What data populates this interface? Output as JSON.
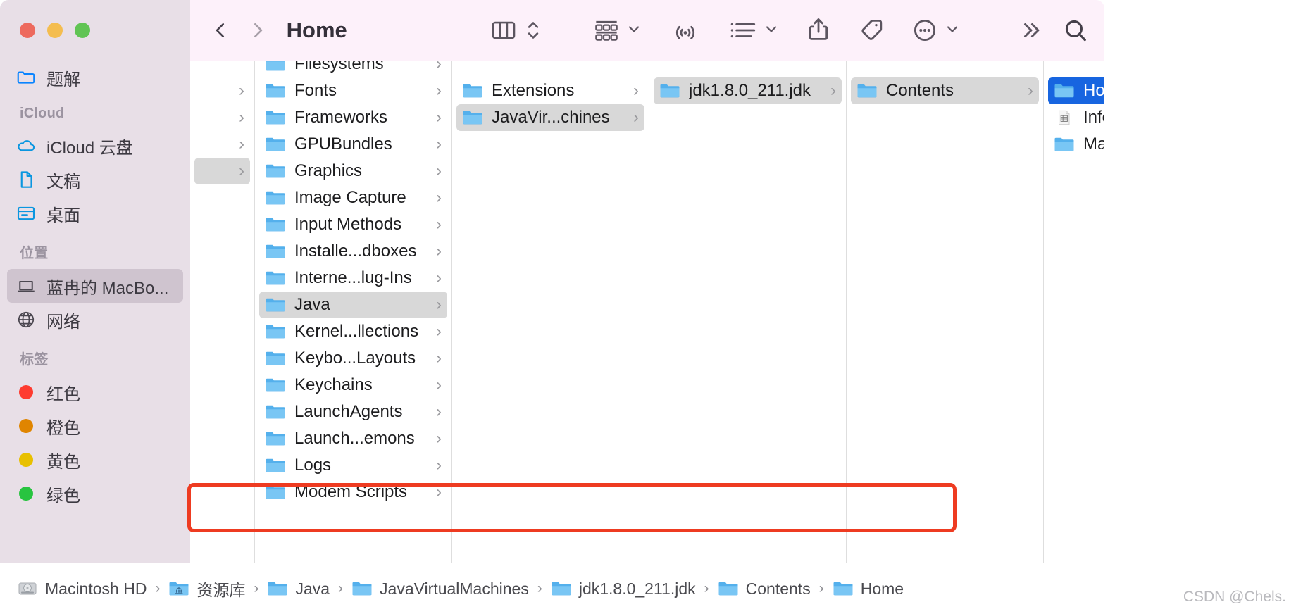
{
  "window": {
    "title": "Home",
    "traffic_lights": [
      {
        "name": "close",
        "color": "#ed6a5e"
      },
      {
        "name": "minimize",
        "color": "#f4bd4f"
      },
      {
        "name": "maximize",
        "color": "#61c454"
      }
    ]
  },
  "toolbar": {
    "back_label": "Back",
    "forward_label": "Forward",
    "title": "Home",
    "view_column_label": "Column View",
    "view_stepper_label": "View Options",
    "group_label": "Group By",
    "airdrop_label": "AirDrop",
    "action_list_label": "Arrange",
    "share_label": "Share",
    "tags_label": "Tags",
    "more_label": "More",
    "overflow_label": "More Toolbar Items",
    "search_label": "Search"
  },
  "sidebar": {
    "top_items": [
      {
        "label": "题解",
        "icon": "folder-outline-icon",
        "selected": false
      }
    ],
    "groups": [
      {
        "title": "iCloud",
        "items": [
          {
            "label": "iCloud 云盘",
            "icon": "cloud-icon",
            "selected": false
          },
          {
            "label": "文稿",
            "icon": "document-icon",
            "selected": false
          },
          {
            "label": "桌面",
            "icon": "desktop-icon",
            "selected": false
          }
        ]
      },
      {
        "title": "位置",
        "items": [
          {
            "label": "蓝冉的 MacBo...",
            "icon": "laptop-icon",
            "selected": true
          },
          {
            "label": "网络",
            "icon": "globe-icon",
            "selected": false
          }
        ]
      },
      {
        "title": "标签",
        "items": [
          {
            "label": "红色",
            "icon": "tag-dot-icon",
            "color": "#fe3b30",
            "selected": false
          },
          {
            "label": "橙色",
            "icon": "tag-dot-icon",
            "color": "#e08500",
            "selected": false
          },
          {
            "label": "黄色",
            "icon": "tag-dot-icon",
            "color": "#e8c000",
            "selected": false
          },
          {
            "label": "绿色",
            "icon": "tag-dot-icon",
            "color": "#28c440",
            "selected": false
          }
        ]
      }
    ]
  },
  "columns": [
    {
      "name": "column-disclosure",
      "rows": [
        {
          "label": "",
          "chevron": true,
          "selected": false
        },
        {
          "label": "",
          "chevron": true,
          "selected": false
        },
        {
          "label": "",
          "chevron": true,
          "selected": false
        },
        {
          "label": "",
          "chevron": true,
          "selected": true
        }
      ]
    },
    {
      "name": "column-library",
      "rows": [
        {
          "label": "Filesystems",
          "chevron": true,
          "selected": false,
          "clipped": true
        },
        {
          "label": "Fonts",
          "chevron": true,
          "selected": false
        },
        {
          "label": "Frameworks",
          "chevron": true,
          "selected": false
        },
        {
          "label": "GPUBundles",
          "chevron": true,
          "selected": false
        },
        {
          "label": "Graphics",
          "chevron": true,
          "selected": false
        },
        {
          "label": "Image Capture",
          "chevron": true,
          "selected": false
        },
        {
          "label": "Input Methods",
          "chevron": true,
          "selected": false
        },
        {
          "label": "Installe...dboxes",
          "chevron": true,
          "selected": false
        },
        {
          "label": "Interne...lug-Ins",
          "chevron": true,
          "selected": false
        },
        {
          "label": "Java",
          "chevron": true,
          "selected": true
        },
        {
          "label": "Kernel...llections",
          "chevron": true,
          "selected": false
        },
        {
          "label": "Keybo...Layouts",
          "chevron": true,
          "selected": false
        },
        {
          "label": "Keychains",
          "chevron": true,
          "selected": false
        },
        {
          "label": "LaunchAgents",
          "chevron": true,
          "selected": false
        },
        {
          "label": "Launch...emons",
          "chevron": true,
          "selected": false
        },
        {
          "label": "Logs",
          "chevron": true,
          "selected": false
        },
        {
          "label": "Modem Scripts",
          "chevron": true,
          "selected": false
        }
      ]
    },
    {
      "name": "column-java",
      "rows": [
        {
          "label": "Extensions",
          "chevron": true,
          "selected": false
        },
        {
          "label": "JavaVir...chines",
          "chevron": true,
          "selected": true
        }
      ]
    },
    {
      "name": "column-javavirtualmachines",
      "rows": [
        {
          "label": "jdk1.8.0_211.jdk",
          "chevron": true,
          "selected": true
        }
      ]
    },
    {
      "name": "column-jdk",
      "rows": [
        {
          "label": "Contents",
          "chevron": true,
          "selected": true
        }
      ]
    },
    {
      "name": "column-contents",
      "rows": [
        {
          "label": "Home",
          "chevron": true,
          "selected_blue": true
        },
        {
          "label": "Info.plist",
          "chevron": false,
          "selected": false,
          "icon": "plist-file-icon"
        },
        {
          "label": "MacOS",
          "chevron": false,
          "selected": false
        }
      ]
    }
  ],
  "pathbar": {
    "crumbs": [
      {
        "label": "Macintosh HD",
        "icon": "harddisk-icon"
      },
      {
        "label": "资源库",
        "icon": "library-folder-icon"
      },
      {
        "label": "Java",
        "icon": "folder-icon"
      },
      {
        "label": "JavaVirtualMachines",
        "icon": "folder-icon"
      },
      {
        "label": "jdk1.8.0_211.jdk",
        "icon": "folder-icon"
      },
      {
        "label": "Contents",
        "icon": "folder-icon"
      },
      {
        "label": "Home",
        "icon": "folder-icon"
      }
    ],
    "separator": "›",
    "highlight_color": "#ee3b21"
  },
  "watermark": {
    "text": "CSDN @Chels."
  },
  "colors": {
    "sidebar_bg": "#e8dfe7",
    "toolbar_bg": "#fdf1fa",
    "selection_gray": "#d8d8d8",
    "selection_blue": "#1765e0",
    "folder_blue": "#5ab4ef"
  }
}
